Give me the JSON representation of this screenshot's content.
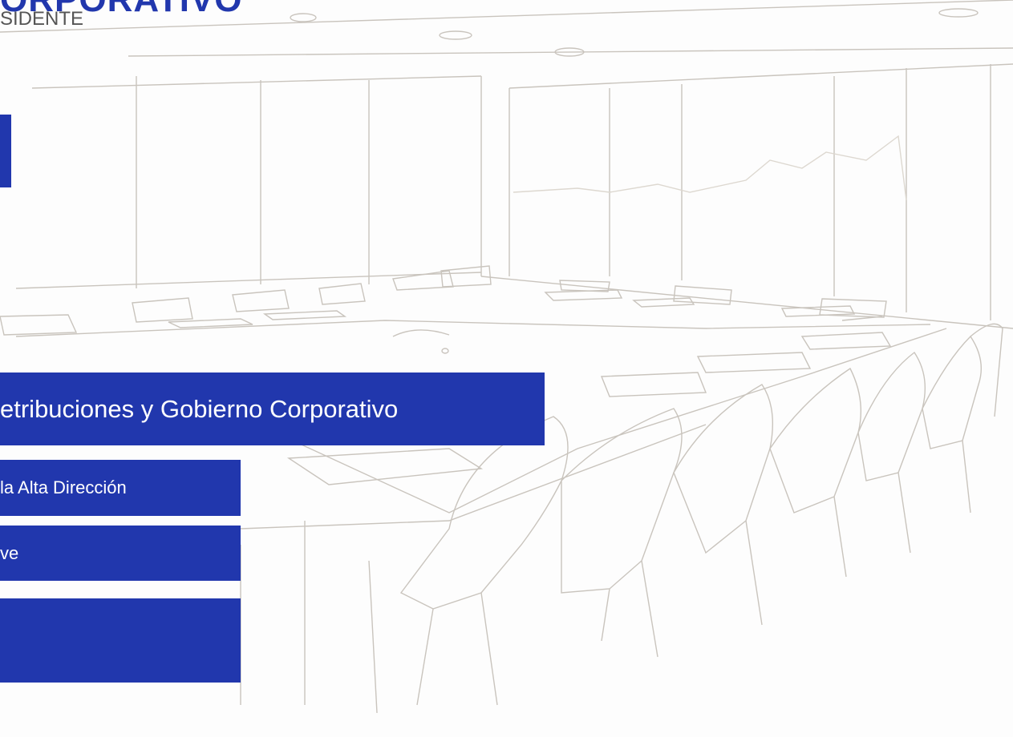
{
  "header": {
    "title": "ORPORATIVO",
    "subtitle": "SIDENTE"
  },
  "banners": {
    "main_label": "etribuciones y Gobierno Corporativo",
    "item_1_label": " la Alta Dirección",
    "item_2_label": "ve",
    "item_3_label": ""
  },
  "background": {
    "description_icon": "boardroom-sketch-image"
  },
  "colors": {
    "brand_blue": "#2137ad",
    "text_gray": "#555555",
    "sketch_line": "#b9b4ad"
  }
}
